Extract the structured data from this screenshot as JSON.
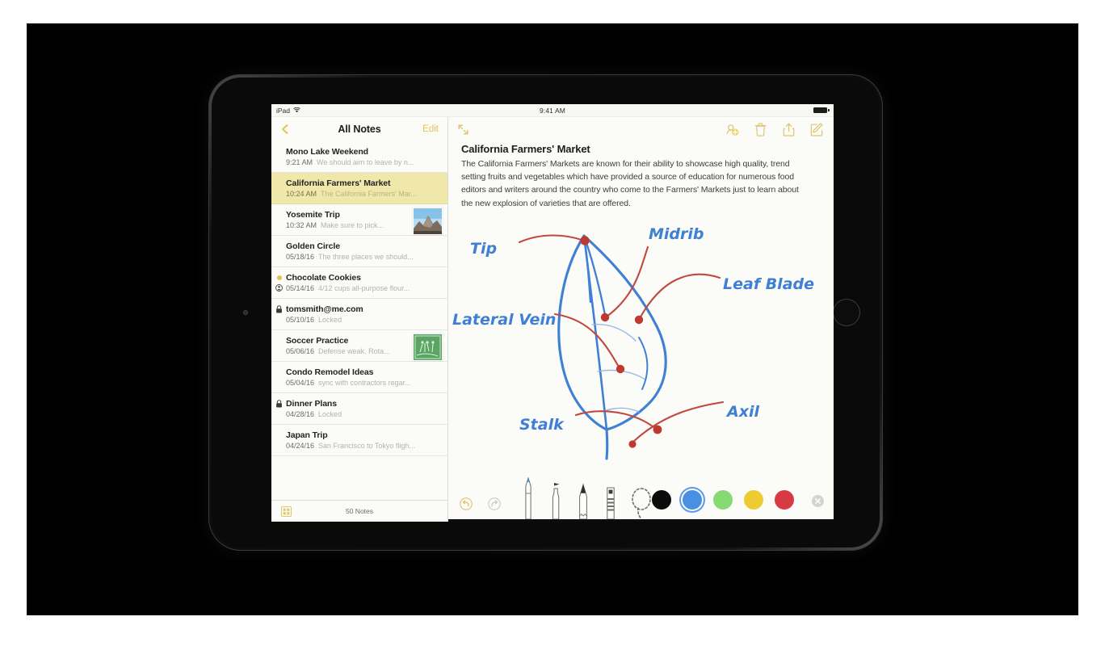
{
  "statusbar": {
    "device_label": "iPad",
    "wifi_icon": "wifi-icon",
    "time": "9:41 AM",
    "battery_icon": "battery-full-icon"
  },
  "sidebar": {
    "back_icon": "chevron-left-icon",
    "title": "All Notes",
    "edit_label": "Edit",
    "gallery_icon": "grid-view-icon",
    "notes_count": "50 Notes",
    "notes": [
      {
        "title": "Mono Lake Weekend",
        "time": "9:21 AM",
        "snippet": "We should aim to leave by n...",
        "selected": false,
        "badge": "none",
        "thumb": "none"
      },
      {
        "title": "California Farmers' Market",
        "time": "10:24 AM",
        "snippet": "The California Farmers' Mar...",
        "selected": true,
        "badge": "none",
        "thumb": "none"
      },
      {
        "title": "Yosemite Trip",
        "time": "10:32 AM",
        "snippet": "Make sure to pick...",
        "selected": false,
        "badge": "none",
        "thumb": "photo-halfdome"
      },
      {
        "title": "Golden Circle",
        "time": "05/18/16",
        "snippet": "The three places we should...",
        "selected": false,
        "badge": "none",
        "thumb": "none"
      },
      {
        "title": "Chocolate Cookies",
        "time": "05/14/16",
        "snippet": "4/12 cups all-purpose flour...",
        "selected": false,
        "badge": "dot-and-shared",
        "thumb": "none"
      },
      {
        "title": "tomsmith@me.com",
        "time": "05/10/16",
        "snippet": "Locked",
        "selected": false,
        "badge": "lock",
        "thumb": "none"
      },
      {
        "title": "Soccer Practice",
        "time": "05/06/16",
        "snippet": "Defense weak. Rota...",
        "selected": false,
        "badge": "none",
        "thumb": "sketch-green"
      },
      {
        "title": "Condo Remodel Ideas",
        "time": "05/04/16",
        "snippet": "sync with contractors regar...",
        "selected": false,
        "badge": "none",
        "thumb": "none"
      },
      {
        "title": "Dinner Plans",
        "time": "04/28/16",
        "snippet": "Locked",
        "selected": false,
        "badge": "lock",
        "thumb": "none"
      },
      {
        "title": "Japan Trip",
        "time": "04/24/16",
        "snippet": "San Francisco to Tokyo fligh...",
        "selected": false,
        "badge": "none",
        "thumb": "none"
      }
    ]
  },
  "detail": {
    "expand_icon": "expand-arrows-icon",
    "actions": [
      {
        "name": "add-collaborator-icon"
      },
      {
        "name": "trash-icon"
      },
      {
        "name": "share-icon"
      },
      {
        "name": "compose-icon"
      }
    ],
    "note_title": "California Farmers' Market",
    "note_text": "The California Farmers' Markets are known for their ability to showcase high quality, trend setting fruits and vegetables which have provided a source of education for numerous food editors and writers around the country who come to the Farmers' Markets just to learn about the new explosion of varieties that are offered."
  },
  "sketch": {
    "labels": {
      "tip": "Tip",
      "midrib": "Midrib",
      "leaf_blade": "Leaf Blade",
      "lateral_vein": "Lateral Vein",
      "stalk": "Stalk",
      "axil": "Axil"
    },
    "ink_blue": "#3f7fd4",
    "ink_red": "#c0392f"
  },
  "draw_toolbar": {
    "undo_icon": "undo-icon",
    "redo_icon": "redo-icon",
    "tools": [
      {
        "name": "pen-tool",
        "selected": true
      },
      {
        "name": "marker-tool",
        "selected": false
      },
      {
        "name": "pencil-tool",
        "selected": false
      },
      {
        "name": "eraser-tool",
        "selected": false
      },
      {
        "name": "lasso-tool",
        "selected": false
      }
    ],
    "colors": [
      {
        "name": "swatch-black",
        "hex": "#0b0b0b",
        "selected": false
      },
      {
        "name": "swatch-blue",
        "hex": "#4a90e2",
        "selected": true
      },
      {
        "name": "swatch-green",
        "hex": "#86da72",
        "selected": false
      },
      {
        "name": "swatch-yellow",
        "hex": "#efcb33",
        "selected": false
      },
      {
        "name": "swatch-red",
        "hex": "#d83a44",
        "selected": false
      }
    ],
    "close_icon": "close-circle-icon"
  }
}
